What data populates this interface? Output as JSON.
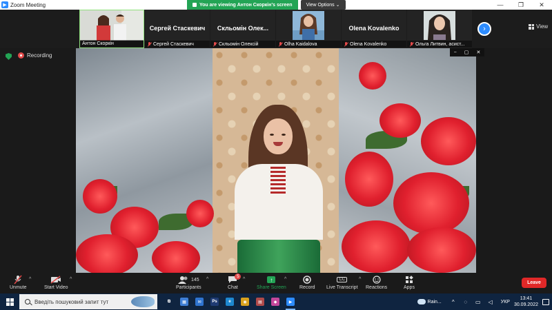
{
  "window": {
    "title": "Zoom Meeting",
    "controls": [
      "—",
      "❐",
      "✕"
    ]
  },
  "share_banner": {
    "message": "You are viewing Антон Скоркін's screen",
    "options_label": "View Options ⌄"
  },
  "thumbnails": [
    {
      "label": "Антон Скоркін",
      "has_video": true,
      "active": true,
      "muted": false
    },
    {
      "big_name": "Сергей Стаскевич",
      "label": "Сергей Стаскевич",
      "has_video": false,
      "muted": true
    },
    {
      "big_name": "Скльомін Олек...",
      "label": "Скльомін Олексій",
      "has_video": false,
      "muted": true
    },
    {
      "label": "Olha Kaidalova",
      "has_video": true,
      "muted": true
    },
    {
      "big_name": "Olena Kovalenko",
      "label": "Olena Kovalenko",
      "has_video": false,
      "muted": true
    },
    {
      "label": "Ольга Литвин, асист...",
      "has_video": true,
      "muted": true
    }
  ],
  "strip": {
    "next_icon": "chevron-right-icon",
    "view_label": "View"
  },
  "meeting": {
    "recording_label": "Recording"
  },
  "video_controls": [
    "−",
    "▢",
    "✕"
  ],
  "toolbar": {
    "unmute": "Unmute",
    "start_video": "Start Video",
    "participants": "Participants",
    "participants_count": "145",
    "chat": "Chat",
    "chat_badge": "5",
    "share_screen": "Share Screen",
    "record": "Record",
    "live_transcript": "Live Transcript",
    "cc_badge": "CC",
    "reactions": "Reactions",
    "apps": "Apps",
    "leave": "Leave"
  },
  "taskbar": {
    "search_placeholder": "Введіть пошуковий запит тут",
    "apps": [
      {
        "name": "task-view-icon",
        "glyph": "⧉",
        "color": "#0f2440"
      },
      {
        "name": "store-icon",
        "glyph": "▦",
        "color": "#3f7fd6"
      },
      {
        "name": "mail-icon",
        "glyph": "✉",
        "color": "#2f74d0"
      },
      {
        "name": "photoshop-icon",
        "glyph": "Ps",
        "color": "#1f3b73"
      },
      {
        "name": "edge-icon",
        "glyph": "e",
        "color": "#1e88d0"
      },
      {
        "name": "chrome-icon",
        "glyph": "◉",
        "color": "#d9a21e"
      },
      {
        "name": "files-icon",
        "glyph": "▤",
        "color": "#b04a4a"
      },
      {
        "name": "ink-icon",
        "glyph": "◆",
        "color": "#c3479b"
      },
      {
        "name": "zoom-icon",
        "glyph": "▶",
        "color": "#2d8cff"
      }
    ],
    "weather": "Rain...",
    "language": "УКР",
    "time": "13:41",
    "date": "30.09.2022"
  },
  "colors": {
    "accent_green": "#23a455",
    "zoom_blue": "#2d8cff",
    "leave_red": "#e02828"
  }
}
